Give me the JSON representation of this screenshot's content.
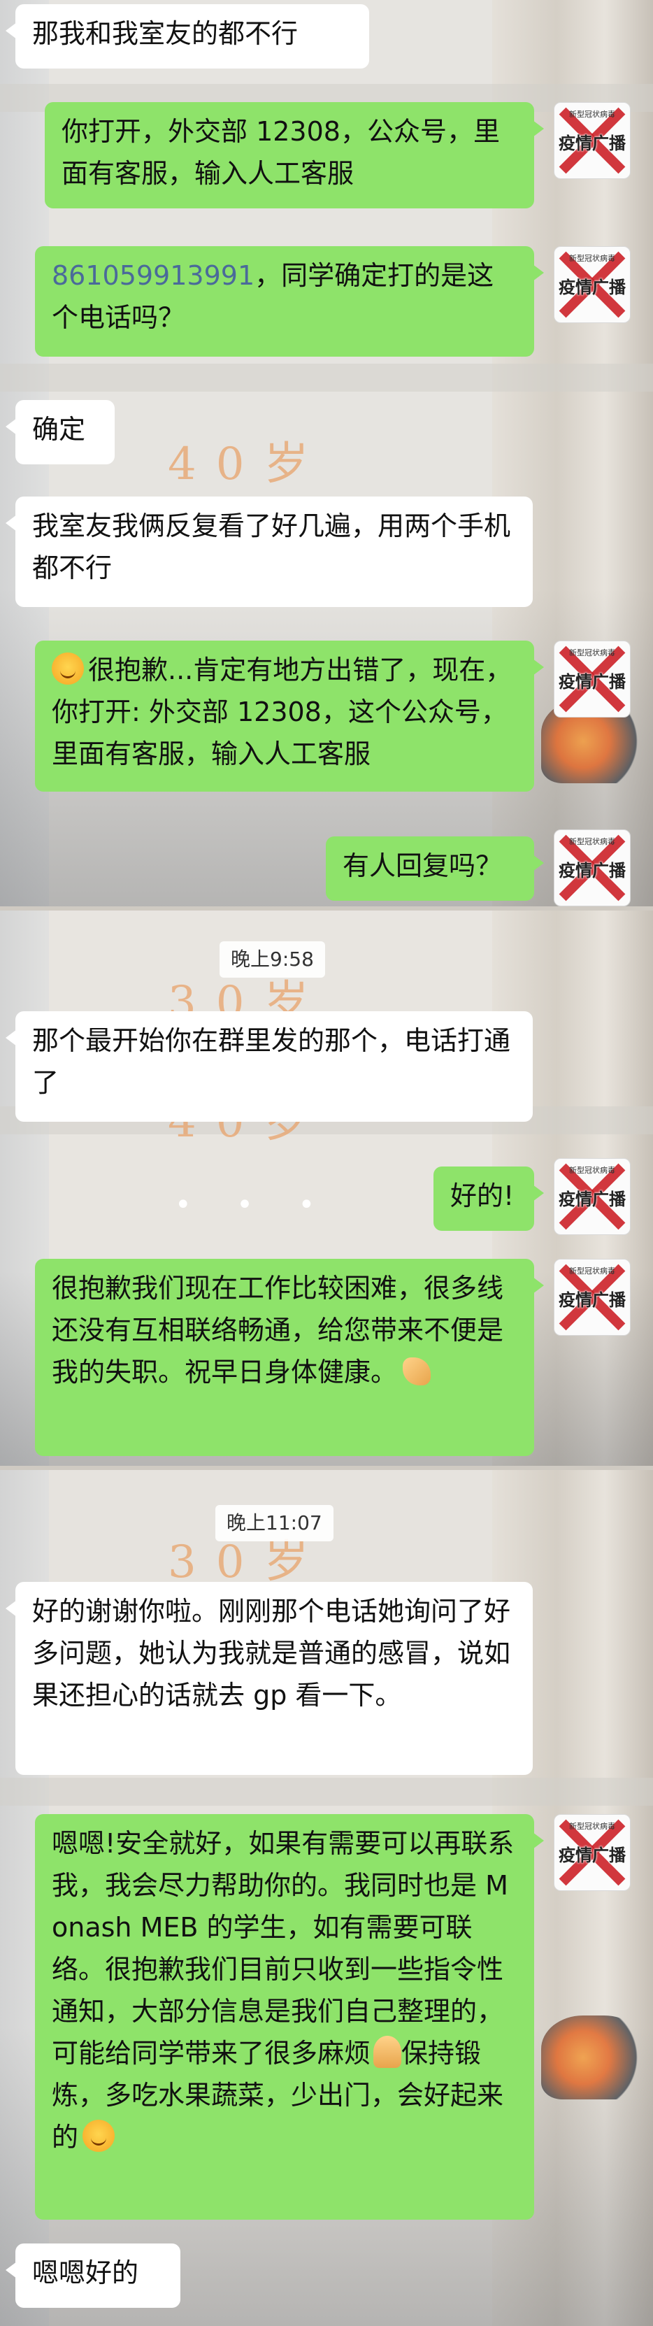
{
  "wallpaper_text": {
    "age_40_a": "40岁",
    "age_30_a": "30岁",
    "age_40_b": "40岁",
    "age_30_b": "30岁"
  },
  "avatar": {
    "small_text": "新型冠状病毒",
    "big_text": "疫情广播"
  },
  "timestamps": [
    "晚上9:58",
    "晚上11:07"
  ],
  "messages": [
    {
      "side": "left",
      "text": "那我和我室友的都不行"
    },
    {
      "side": "right",
      "text": "你打开，外交部 12308，公众号，里面有客服，输入人工客服"
    },
    {
      "side": "right",
      "number": "861059913991",
      "text": "，同学确定打的是这个电话吗？"
    },
    {
      "side": "left",
      "text": "确定"
    },
    {
      "side": "left",
      "text": "我室友我俩反复看了好几遍，用两个手机都不行"
    },
    {
      "side": "right",
      "emoji": "smiling-face",
      "text": "很抱歉...肯定有地方出错了，现在，你打开: 外交部 12308，这个公众号，里面有客服，输入人工客服"
    },
    {
      "side": "right",
      "text": "有人回复吗？"
    },
    {
      "side": "left",
      "text": "那个最开始你在群里发的那个，电话打通了"
    },
    {
      "side": "right",
      "text": "好的!"
    },
    {
      "side": "right",
      "text": "很抱歉我们现在工作比较困难，很多线还没有互相联络畅通，给您带来不便是我的失职。祝早日身体健康。",
      "emoji": "thumb-hand"
    },
    {
      "side": "left",
      "text": "好的谢谢你啦。刚刚那个电话她询问了好多问题，她认为我就是普通的感冒，说如果还担心的话就去 gp 看一下。"
    },
    {
      "side": "right",
      "text_a": "嗯嗯!安全就好，如果有需要可以再联系我，我会尽力帮助你的。我同时也是 Monash MEB 的学生，如有需要可联络。很抱歉我们目前只收到一些指令性通知，大部分信息是我们自己整理的，可能给同学带来了很多麻烦",
      "text_b": "保持锻炼，多吃水果蔬菜，少出门，会好起来的",
      "emoji_a": "folded-hands",
      "emoji_b": "smiling-face"
    },
    {
      "side": "left",
      "text": "嗯嗯好的"
    }
  ],
  "dots": "• • •"
}
